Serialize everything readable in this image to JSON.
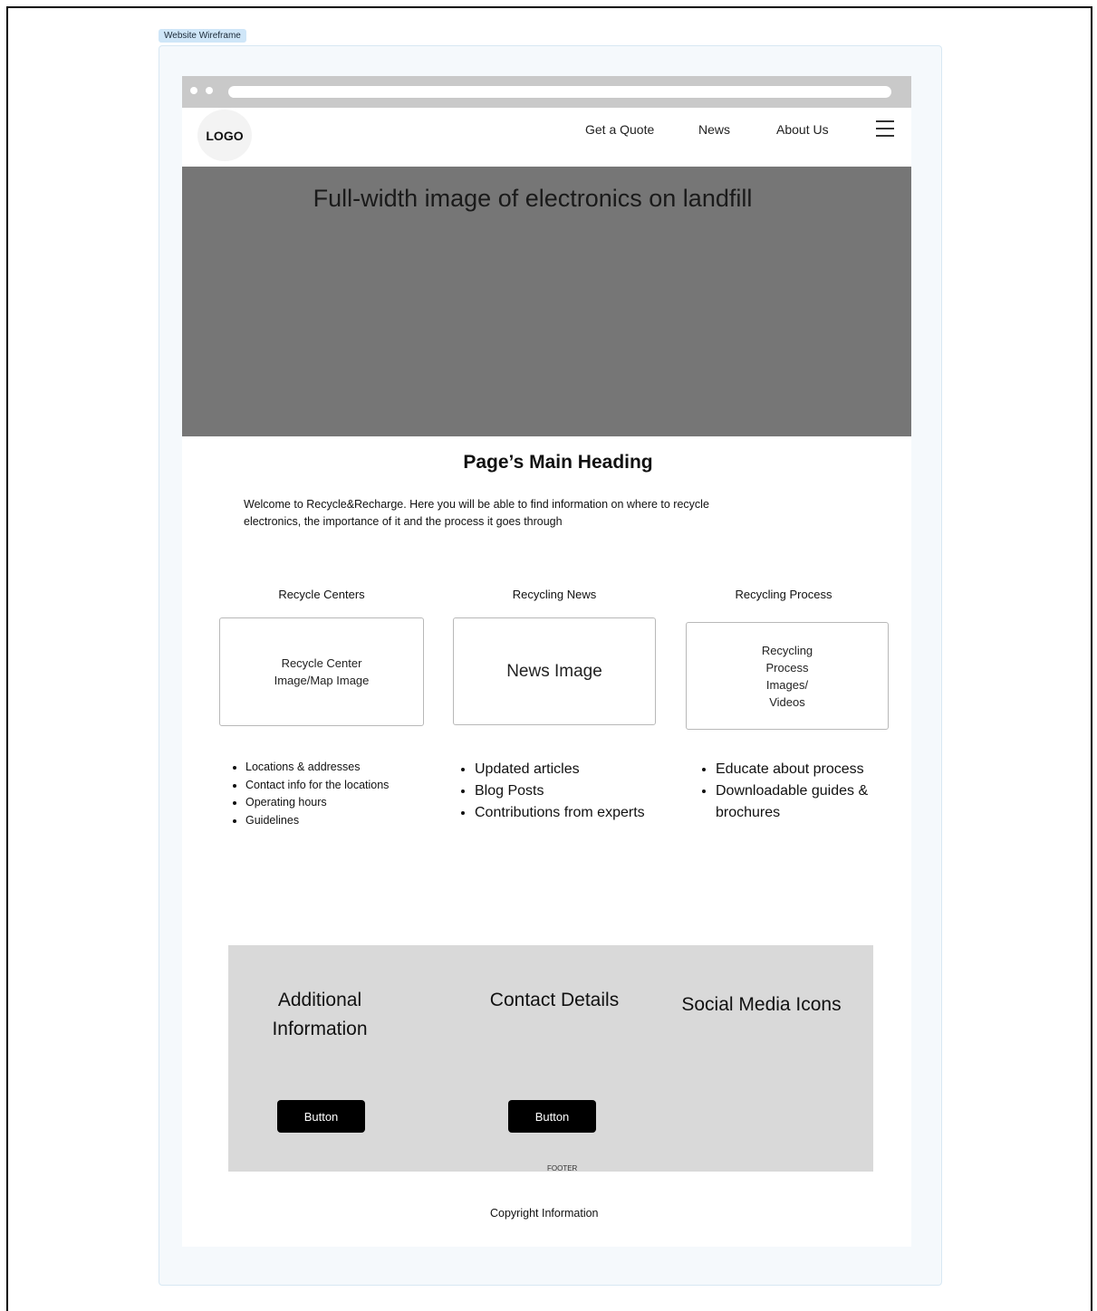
{
  "frame_label": "Website Wireframe",
  "header": {
    "logo": "LOGO",
    "nav": [
      "Get a Quote",
      "News",
      "About Us"
    ],
    "menu_icon": "hamburger-icon"
  },
  "hero": {
    "text": "Full-width image of electronics on landfill"
  },
  "main": {
    "heading": "Page’s Main Heading",
    "intro_line1": "Welcome to Recycle&Recharge. Here you will be able to find information on where to recycle",
    "intro_line2": "electronics, the importance of it and the process it goes through"
  },
  "columns": [
    {
      "title": "Recycle Centers",
      "card_lines": [
        "Recycle Center",
        "Image/Map Image"
      ],
      "bullets": [
        "Locations & addresses",
        "Contact info for the locations",
        "Operating hours",
        "Guidelines"
      ]
    },
    {
      "title": "Recycling News",
      "card_lines": [
        "News Image"
      ],
      "bullets": [
        "Updated articles",
        "Blog Posts",
        "Contributions from experts"
      ]
    },
    {
      "title": "Recycling Process",
      "card_lines": [
        "Recycling",
        "Process",
        "Images/",
        "Videos"
      ],
      "bullets": [
        "Educate about process",
        "Downloadable guides & brochures"
      ]
    }
  ],
  "footer": {
    "additional_line1": "Additional",
    "additional_line2": "Information",
    "contact": "Contact Details",
    "social": "Social Media Icons",
    "button1": "Button",
    "button2": "Button",
    "label": "FOOTER",
    "copyright": "Copyright Information"
  },
  "colors": {
    "hero": "#767676",
    "footer": "#d9d9d9",
    "button": "#000000",
    "browser_bar": "#c9c9c9"
  }
}
